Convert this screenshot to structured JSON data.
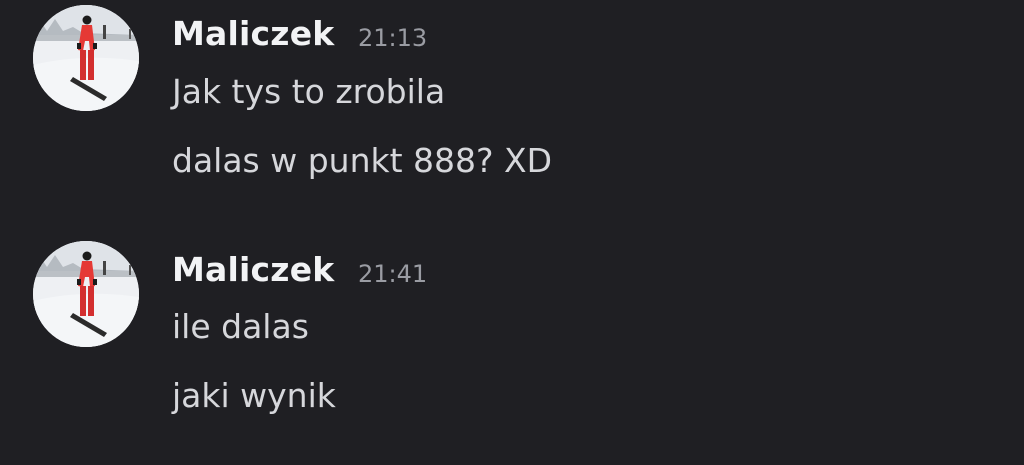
{
  "messages": [
    {
      "author": "Maliczek",
      "time": "21:13",
      "lines": [
        "Jak tys to zrobila",
        "dalas w punkt 888? XD"
      ]
    },
    {
      "author": "Maliczek",
      "time": "21:41",
      "lines": [
        "ile dalas",
        "jaki wynik"
      ]
    }
  ],
  "colors": {
    "background": "#1f1f23",
    "username": "#f2f3f5",
    "text": "#d6d7db",
    "timestamp": "#9a9ca3"
  }
}
